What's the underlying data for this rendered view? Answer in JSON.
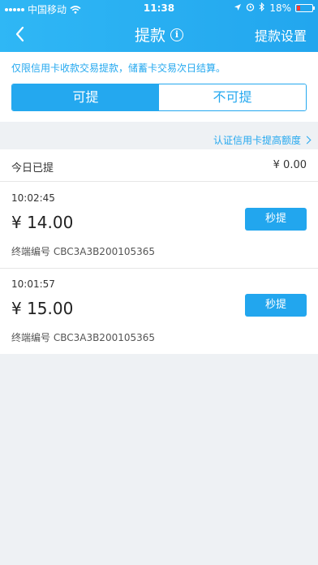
{
  "status_bar": {
    "carrier": "中国移动",
    "time": "11:38",
    "battery": "18%",
    "icons": [
      "signal-icon",
      "wifi-icon",
      "location-icon",
      "alarm-icon",
      "bluetooth-icon",
      "battery-icon"
    ]
  },
  "nav": {
    "title": "提款",
    "info_glyph": "i",
    "settings": "提款设置"
  },
  "notice": {
    "text": "仅限信用卡收款交易提款，储蓄卡交易次日结算。"
  },
  "tabs": [
    {
      "label": "可提",
      "active": true
    },
    {
      "label": "不可提",
      "active": false
    }
  ],
  "upgrade_link": "认证信用卡提高额度",
  "today": {
    "label": "今日已提",
    "amount": "¥ 0.00"
  },
  "records": [
    {
      "time": "10:02:45",
      "amount": "¥ 14.00",
      "terminal": "终端编号  CBC3A3B200105365",
      "button": "秒提"
    },
    {
      "time": "10:01:57",
      "amount": "¥ 15.00",
      "terminal": "终端编号  CBC3A3B200105365",
      "button": "秒提"
    }
  ],
  "colors": {
    "accent": "#24a8ef",
    "header": "#2fb7f5",
    "background": "#eef1f4",
    "battery_low": "#ff3b30"
  }
}
